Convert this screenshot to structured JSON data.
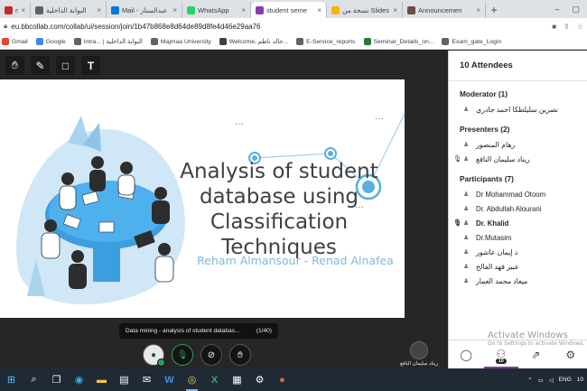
{
  "browser": {
    "tabs": [
      {
        "label": "msati",
        "color": "#c62828"
      },
      {
        "label": "البوابة الداخلية",
        "color": "#5f6368"
      },
      {
        "label": "Mail - عبدالستار",
        "color": "#0078d4"
      },
      {
        "label": "WhatsApp",
        "color": "#25d366"
      },
      {
        "label": "student seme",
        "color": "#8a3aa8"
      },
      {
        "label": "نسخة من Slides",
        "color": "#f4b400"
      },
      {
        "label": "Announcemen",
        "color": "#6d4c41"
      }
    ],
    "active_tab_index": 4,
    "url": "eu.bbcollab.com/collab/ui/session/join/1b47b868e8d64de89d8fe4d46e29aa76",
    "bookmarks": [
      {
        "label": "Gmail",
        "color": "#ea4335"
      },
      {
        "label": "Google",
        "color": "#4285f4"
      },
      {
        "label": "Intra... | البوابة الداخلية",
        "color": "#5f6368"
      },
      {
        "label": "Majmaa University",
        "color": "#5f6368"
      },
      {
        "label": "Welcome, خالد ناظم...",
        "color": "#3c4043"
      },
      {
        "label": "E-Service_reports",
        "color": "#5f6368"
      },
      {
        "label": "Seminar_Details_on...",
        "color": "#1e7e34"
      },
      {
        "label": "Exam_gate_Login",
        "color": "#5f6368"
      }
    ]
  },
  "slide": {
    "title": "Analysis of student database using Classification Techniques",
    "authors": "Reham Almansour -  Renad Alnafea"
  },
  "caption": {
    "text": "Data mining - analysis of student databas...",
    "page": "(1/40)"
  },
  "speaker": {
    "name": "ريناد سليمان النافع"
  },
  "panel": {
    "title": "10 Attendees",
    "sections": [
      {
        "title": "Moderator (1)",
        "people": [
          {
            "name": "نصرين سليلطكا احمد جادري",
            "mic": false,
            "bold": false
          }
        ]
      },
      {
        "title": "Presenters (2)",
        "people": [
          {
            "name": "رهام المنصور",
            "mic": false,
            "bold": false
          },
          {
            "name": "ريناد سليمان النافع",
            "mic": true,
            "bold": false
          }
        ]
      },
      {
        "title": "Participants (7)",
        "people": [
          {
            "name": "Dr Mohammad Otoom",
            "mic": false,
            "bold": false
          },
          {
            "name": "Dr. Abdullah Alourani",
            "mic": false,
            "bold": false
          },
          {
            "name": "Dr. Khalid",
            "mic": true,
            "bold": true
          },
          {
            "name": "Dr.Mutasim",
            "mic": false,
            "bold": false
          },
          {
            "name": "د إيمان عاشور",
            "mic": false,
            "bold": false
          },
          {
            "name": "عبير فهد الفالح",
            "mic": false,
            "bold": false
          },
          {
            "name": "ميعاد محمد العمار",
            "mic": false,
            "bold": false
          }
        ]
      }
    ],
    "attendee_count": "10"
  },
  "watermark": {
    "line1": "Activate Windows",
    "line2": "Go to Settings to activate Windows."
  },
  "taskbar": {
    "lang": "ENG",
    "clock": "10"
  },
  "colors": {
    "accent": "#8a3aa8",
    "slide_author": "#7fb9da",
    "title_text": "#404040"
  }
}
